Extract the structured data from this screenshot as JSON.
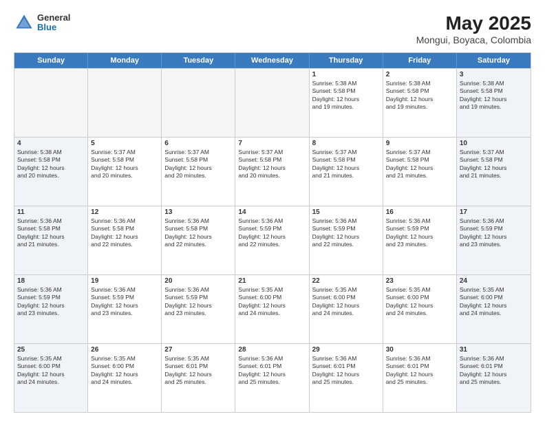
{
  "logo": {
    "general": "General",
    "blue": "Blue"
  },
  "title": "May 2025",
  "subtitle": "Mongui, Boyaca, Colombia",
  "weekdays": [
    "Sunday",
    "Monday",
    "Tuesday",
    "Wednesday",
    "Thursday",
    "Friday",
    "Saturday"
  ],
  "weeks": [
    [
      {
        "day": "",
        "info": "",
        "empty": true
      },
      {
        "day": "",
        "info": "",
        "empty": true
      },
      {
        "day": "",
        "info": "",
        "empty": true
      },
      {
        "day": "",
        "info": "",
        "empty": true
      },
      {
        "day": "1",
        "info": "Sunrise: 5:38 AM\nSunset: 5:58 PM\nDaylight: 12 hours\nand 19 minutes.",
        "empty": false,
        "weekend": false
      },
      {
        "day": "2",
        "info": "Sunrise: 5:38 AM\nSunset: 5:58 PM\nDaylight: 12 hours\nand 19 minutes.",
        "empty": false,
        "weekend": false
      },
      {
        "day": "3",
        "info": "Sunrise: 5:38 AM\nSunset: 5:58 PM\nDaylight: 12 hours\nand 19 minutes.",
        "empty": false,
        "weekend": true
      }
    ],
    [
      {
        "day": "4",
        "info": "Sunrise: 5:38 AM\nSunset: 5:58 PM\nDaylight: 12 hours\nand 20 minutes.",
        "empty": false,
        "weekend": true
      },
      {
        "day": "5",
        "info": "Sunrise: 5:37 AM\nSunset: 5:58 PM\nDaylight: 12 hours\nand 20 minutes.",
        "empty": false,
        "weekend": false
      },
      {
        "day": "6",
        "info": "Sunrise: 5:37 AM\nSunset: 5:58 PM\nDaylight: 12 hours\nand 20 minutes.",
        "empty": false,
        "weekend": false
      },
      {
        "day": "7",
        "info": "Sunrise: 5:37 AM\nSunset: 5:58 PM\nDaylight: 12 hours\nand 20 minutes.",
        "empty": false,
        "weekend": false
      },
      {
        "day": "8",
        "info": "Sunrise: 5:37 AM\nSunset: 5:58 PM\nDaylight: 12 hours\nand 21 minutes.",
        "empty": false,
        "weekend": false
      },
      {
        "day": "9",
        "info": "Sunrise: 5:37 AM\nSunset: 5:58 PM\nDaylight: 12 hours\nand 21 minutes.",
        "empty": false,
        "weekend": false
      },
      {
        "day": "10",
        "info": "Sunrise: 5:37 AM\nSunset: 5:58 PM\nDaylight: 12 hours\nand 21 minutes.",
        "empty": false,
        "weekend": true
      }
    ],
    [
      {
        "day": "11",
        "info": "Sunrise: 5:36 AM\nSunset: 5:58 PM\nDaylight: 12 hours\nand 21 minutes.",
        "empty": false,
        "weekend": true
      },
      {
        "day": "12",
        "info": "Sunrise: 5:36 AM\nSunset: 5:58 PM\nDaylight: 12 hours\nand 22 minutes.",
        "empty": false,
        "weekend": false
      },
      {
        "day": "13",
        "info": "Sunrise: 5:36 AM\nSunset: 5:58 PM\nDaylight: 12 hours\nand 22 minutes.",
        "empty": false,
        "weekend": false
      },
      {
        "day": "14",
        "info": "Sunrise: 5:36 AM\nSunset: 5:59 PM\nDaylight: 12 hours\nand 22 minutes.",
        "empty": false,
        "weekend": false
      },
      {
        "day": "15",
        "info": "Sunrise: 5:36 AM\nSunset: 5:59 PM\nDaylight: 12 hours\nand 22 minutes.",
        "empty": false,
        "weekend": false
      },
      {
        "day": "16",
        "info": "Sunrise: 5:36 AM\nSunset: 5:59 PM\nDaylight: 12 hours\nand 23 minutes.",
        "empty": false,
        "weekend": false
      },
      {
        "day": "17",
        "info": "Sunrise: 5:36 AM\nSunset: 5:59 PM\nDaylight: 12 hours\nand 23 minutes.",
        "empty": false,
        "weekend": true
      }
    ],
    [
      {
        "day": "18",
        "info": "Sunrise: 5:36 AM\nSunset: 5:59 PM\nDaylight: 12 hours\nand 23 minutes.",
        "empty": false,
        "weekend": true
      },
      {
        "day": "19",
        "info": "Sunrise: 5:36 AM\nSunset: 5:59 PM\nDaylight: 12 hours\nand 23 minutes.",
        "empty": false,
        "weekend": false
      },
      {
        "day": "20",
        "info": "Sunrise: 5:36 AM\nSunset: 5:59 PM\nDaylight: 12 hours\nand 23 minutes.",
        "empty": false,
        "weekend": false
      },
      {
        "day": "21",
        "info": "Sunrise: 5:35 AM\nSunset: 6:00 PM\nDaylight: 12 hours\nand 24 minutes.",
        "empty": false,
        "weekend": false
      },
      {
        "day": "22",
        "info": "Sunrise: 5:35 AM\nSunset: 6:00 PM\nDaylight: 12 hours\nand 24 minutes.",
        "empty": false,
        "weekend": false
      },
      {
        "day": "23",
        "info": "Sunrise: 5:35 AM\nSunset: 6:00 PM\nDaylight: 12 hours\nand 24 minutes.",
        "empty": false,
        "weekend": false
      },
      {
        "day": "24",
        "info": "Sunrise: 5:35 AM\nSunset: 6:00 PM\nDaylight: 12 hours\nand 24 minutes.",
        "empty": false,
        "weekend": true
      }
    ],
    [
      {
        "day": "25",
        "info": "Sunrise: 5:35 AM\nSunset: 6:00 PM\nDaylight: 12 hours\nand 24 minutes.",
        "empty": false,
        "weekend": true
      },
      {
        "day": "26",
        "info": "Sunrise: 5:35 AM\nSunset: 6:00 PM\nDaylight: 12 hours\nand 24 minutes.",
        "empty": false,
        "weekend": false
      },
      {
        "day": "27",
        "info": "Sunrise: 5:35 AM\nSunset: 6:01 PM\nDaylight: 12 hours\nand 25 minutes.",
        "empty": false,
        "weekend": false
      },
      {
        "day": "28",
        "info": "Sunrise: 5:36 AM\nSunset: 6:01 PM\nDaylight: 12 hours\nand 25 minutes.",
        "empty": false,
        "weekend": false
      },
      {
        "day": "29",
        "info": "Sunrise: 5:36 AM\nSunset: 6:01 PM\nDaylight: 12 hours\nand 25 minutes.",
        "empty": false,
        "weekend": false
      },
      {
        "day": "30",
        "info": "Sunrise: 5:36 AM\nSunset: 6:01 PM\nDaylight: 12 hours\nand 25 minutes.",
        "empty": false,
        "weekend": false
      },
      {
        "day": "31",
        "info": "Sunrise: 5:36 AM\nSunset: 6:01 PM\nDaylight: 12 hours\nand 25 minutes.",
        "empty": false,
        "weekend": true
      }
    ]
  ]
}
